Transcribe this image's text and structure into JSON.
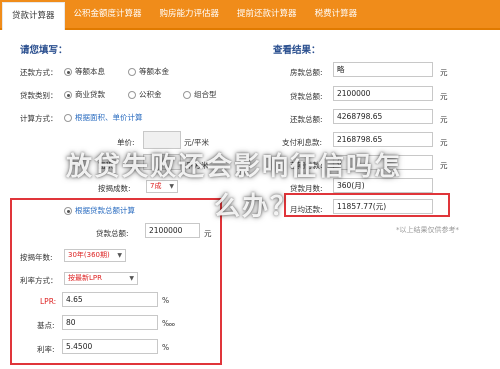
{
  "tabs": [
    "贷款计算器",
    "公积金额度计算器",
    "购房能力评估器",
    "提前还款计算器",
    "税费计算器"
  ],
  "left": {
    "title": "请您填写：",
    "repay_label": "还款方式：",
    "repay_opts": [
      "等额本息",
      "等额本金"
    ],
    "type_label": "贷款类别：",
    "type_opts": [
      "商业贷款",
      "公积金",
      "组合型"
    ],
    "calc_label": "计算方式：",
    "calc_opt1": "根据面积、单价计算",
    "unit_price_label": "单价:",
    "unit_price_unit": "元/平米",
    "area_label": "面积:",
    "area_unit": "平方米",
    "ratio_label": "按揭成数:",
    "ratio_value": "7成",
    "calc_opt2": "根据贷款总额计算",
    "loan_total_label": "贷款总额:",
    "loan_total_value": "2100000",
    "loan_total_unit": "元",
    "years_label": "按揭年数:",
    "years_value": "30年(360期)",
    "rate_mode_label": "利率方式：",
    "rate_mode_value": "按最新LPR",
    "lpr_label": "LPR:",
    "lpr_value": "4.65",
    "lpr_unit": "%",
    "bp_label": "基点:",
    "bp_value": "80",
    "bp_unit": "‱",
    "rate_label": "利率:",
    "rate_value": "5.4500",
    "rate_unit": "%"
  },
  "right": {
    "title": "查看结果：",
    "rows": [
      {
        "label": "房款总额:",
        "value": "略",
        "unit": "元"
      },
      {
        "label": "贷款总额:",
        "value": "2100000",
        "unit": "元"
      },
      {
        "label": "还款总额:",
        "value": "4268798.65",
        "unit": "元"
      },
      {
        "label": "支付利息款:",
        "value": "2168798.65",
        "unit": "元"
      },
      {
        "label": "首期付款:",
        "value": "0",
        "unit": "元"
      },
      {
        "label": "贷款月数:",
        "value": "360(月)",
        "unit": ""
      },
      {
        "label": "月均还款:",
        "value": "11857.77(元)",
        "unit": ""
      }
    ],
    "note": "*以上结果仅供参考*"
  },
  "overlay": {
    "line1": "放贷失败还会影响征信吗怎",
    "line2": "么办？"
  }
}
